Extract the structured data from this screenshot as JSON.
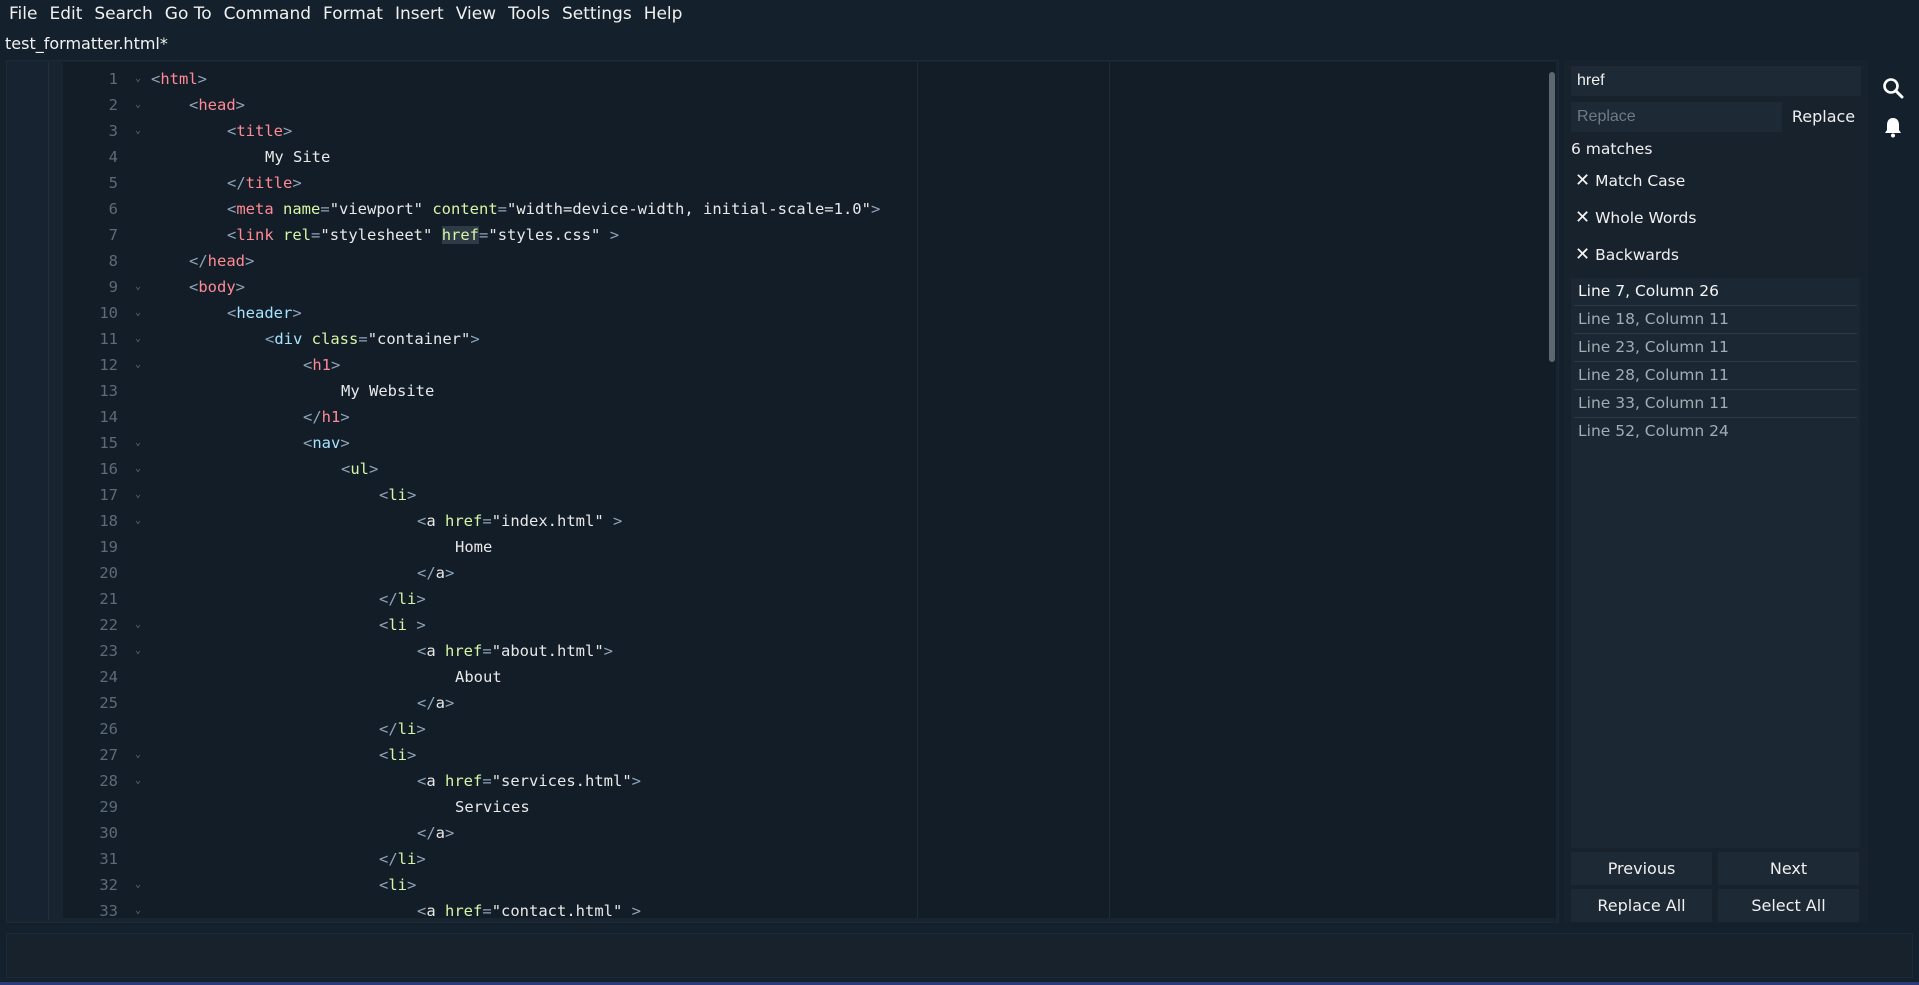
{
  "menu": [
    "File",
    "Edit",
    "Search",
    "Go To",
    "Command",
    "Format",
    "Insert",
    "View",
    "Tools",
    "Settings",
    "Help"
  ],
  "tab_title": "test_formatter.html*",
  "editor": {
    "lines": [
      {
        "n": "1",
        "fold": true,
        "indent": 0,
        "tokens": [
          [
            "p",
            "<"
          ],
          [
            "t",
            "html"
          ],
          [
            "p",
            ">"
          ]
        ]
      },
      {
        "n": "2",
        "fold": true,
        "indent": 1,
        "tokens": [
          [
            "p",
            "<"
          ],
          [
            "t",
            "head"
          ],
          [
            "p",
            ">"
          ]
        ]
      },
      {
        "n": "3",
        "fold": true,
        "indent": 2,
        "tokens": [
          [
            "p",
            "<"
          ],
          [
            "t",
            "title"
          ],
          [
            "p",
            ">"
          ]
        ]
      },
      {
        "n": "4",
        "fold": false,
        "indent": 3,
        "tokens": [
          [
            "s",
            "My Site"
          ]
        ]
      },
      {
        "n": "5",
        "fold": false,
        "indent": 2,
        "tokens": [
          [
            "p",
            "</"
          ],
          [
            "t",
            "title"
          ],
          [
            "p",
            ">"
          ]
        ]
      },
      {
        "n": "6",
        "fold": false,
        "indent": 2,
        "tokens": [
          [
            "p",
            "<"
          ],
          [
            "t",
            "meta "
          ],
          [
            "a",
            "name"
          ],
          [
            "p",
            "="
          ],
          [
            "s",
            "\"viewport\" "
          ],
          [
            "a",
            "content"
          ],
          [
            "p",
            "="
          ],
          [
            "s",
            "\"width=device-width, initial-scale=1.0\""
          ],
          [
            "p",
            ">"
          ]
        ]
      },
      {
        "n": "7",
        "fold": false,
        "indent": 2,
        "tokens": [
          [
            "p",
            "<"
          ],
          [
            "t",
            "link "
          ],
          [
            "a",
            "rel"
          ],
          [
            "p",
            "="
          ],
          [
            "s",
            "\"stylesheet\" "
          ],
          [
            "h",
            "href"
          ],
          [
            "p",
            "="
          ],
          [
            "s",
            "\"styles.css\" "
          ],
          [
            "p",
            ">"
          ]
        ]
      },
      {
        "n": "8",
        "fold": false,
        "indent": 1,
        "tokens": [
          [
            "p",
            "</"
          ],
          [
            "t",
            "head"
          ],
          [
            "p",
            ">"
          ]
        ]
      },
      {
        "n": "9",
        "fold": true,
        "indent": 1,
        "tokens": [
          [
            "p",
            "<"
          ],
          [
            "t",
            "body"
          ],
          [
            "p",
            ">"
          ]
        ]
      },
      {
        "n": "10",
        "fold": true,
        "indent": 2,
        "tokens": [
          [
            "p",
            "<"
          ],
          [
            "t2",
            "header"
          ],
          [
            "p",
            ">"
          ]
        ]
      },
      {
        "n": "11",
        "fold": true,
        "indent": 3,
        "tokens": [
          [
            "p",
            "<"
          ],
          [
            "t2",
            "div "
          ],
          [
            "a",
            "class"
          ],
          [
            "p",
            "="
          ],
          [
            "s",
            "\"container\""
          ],
          [
            "p",
            ">"
          ]
        ]
      },
      {
        "n": "12",
        "fold": true,
        "indent": 4,
        "tokens": [
          [
            "p",
            "<"
          ],
          [
            "t",
            "h1"
          ],
          [
            "p",
            ">"
          ]
        ]
      },
      {
        "n": "13",
        "fold": false,
        "indent": 5,
        "tokens": [
          [
            "s",
            "My Website"
          ]
        ]
      },
      {
        "n": "14",
        "fold": false,
        "indent": 4,
        "tokens": [
          [
            "p",
            "</"
          ],
          [
            "t",
            "h1"
          ],
          [
            "p",
            ">"
          ]
        ]
      },
      {
        "n": "15",
        "fold": true,
        "indent": 4,
        "tokens": [
          [
            "p",
            "<"
          ],
          [
            "t2",
            "nav"
          ],
          [
            "p",
            ">"
          ]
        ]
      },
      {
        "n": "16",
        "fold": true,
        "indent": 5,
        "tokens": [
          [
            "p",
            "<"
          ],
          [
            "a",
            "ul"
          ],
          [
            "p",
            ">"
          ]
        ]
      },
      {
        "n": "17",
        "fold": true,
        "indent": 6,
        "tokens": [
          [
            "p",
            "<"
          ],
          [
            "a",
            "li"
          ],
          [
            "p",
            ">"
          ]
        ]
      },
      {
        "n": "18",
        "fold": true,
        "indent": 7,
        "tokens": [
          [
            "p",
            "<"
          ],
          [
            "s",
            "a "
          ],
          [
            "a",
            "href"
          ],
          [
            "p",
            "="
          ],
          [
            "s",
            "\"index.html\" "
          ],
          [
            "p",
            ">"
          ]
        ]
      },
      {
        "n": "19",
        "fold": false,
        "indent": 8,
        "tokens": [
          [
            "s",
            "Home"
          ]
        ]
      },
      {
        "n": "20",
        "fold": false,
        "indent": 7,
        "tokens": [
          [
            "p",
            "</"
          ],
          [
            "s",
            "a"
          ],
          [
            "p",
            ">"
          ]
        ]
      },
      {
        "n": "21",
        "fold": false,
        "indent": 6,
        "tokens": [
          [
            "p",
            "</"
          ],
          [
            "a",
            "li"
          ],
          [
            "p",
            ">"
          ]
        ]
      },
      {
        "n": "22",
        "fold": true,
        "indent": 6,
        "tokens": [
          [
            "p",
            "<"
          ],
          [
            "a",
            "li "
          ],
          [
            "p",
            ">"
          ]
        ]
      },
      {
        "n": "23",
        "fold": true,
        "indent": 7,
        "tokens": [
          [
            "p",
            "<"
          ],
          [
            "s",
            "a "
          ],
          [
            "a",
            "href"
          ],
          [
            "p",
            "="
          ],
          [
            "s",
            "\"about.html\""
          ],
          [
            "p",
            ">"
          ]
        ]
      },
      {
        "n": "24",
        "fold": false,
        "indent": 8,
        "tokens": [
          [
            "s",
            "About"
          ]
        ]
      },
      {
        "n": "25",
        "fold": false,
        "indent": 7,
        "tokens": [
          [
            "p",
            "</"
          ],
          [
            "s",
            "a"
          ],
          [
            "p",
            ">"
          ]
        ]
      },
      {
        "n": "26",
        "fold": false,
        "indent": 6,
        "tokens": [
          [
            "p",
            "</"
          ],
          [
            "a",
            "li"
          ],
          [
            "p",
            ">"
          ]
        ]
      },
      {
        "n": "27",
        "fold": true,
        "indent": 6,
        "tokens": [
          [
            "p",
            "<"
          ],
          [
            "a",
            "li"
          ],
          [
            "p",
            ">"
          ]
        ]
      },
      {
        "n": "28",
        "fold": true,
        "indent": 7,
        "tokens": [
          [
            "p",
            "<"
          ],
          [
            "s",
            "a "
          ],
          [
            "a",
            "href"
          ],
          [
            "p",
            "="
          ],
          [
            "s",
            "\"services.html\""
          ],
          [
            "p",
            ">"
          ]
        ]
      },
      {
        "n": "29",
        "fold": false,
        "indent": 8,
        "tokens": [
          [
            "s",
            "Services"
          ]
        ]
      },
      {
        "n": "30",
        "fold": false,
        "indent": 7,
        "tokens": [
          [
            "p",
            "</"
          ],
          [
            "s",
            "a"
          ],
          [
            "p",
            ">"
          ]
        ]
      },
      {
        "n": "31",
        "fold": false,
        "indent": 6,
        "tokens": [
          [
            "p",
            "</"
          ],
          [
            "a",
            "li"
          ],
          [
            "p",
            ">"
          ]
        ]
      },
      {
        "n": "32",
        "fold": true,
        "indent": 6,
        "tokens": [
          [
            "p",
            "<"
          ],
          [
            "a",
            "li"
          ],
          [
            "p",
            ">"
          ]
        ]
      },
      {
        "n": "33",
        "fold": true,
        "indent": 7,
        "tokens": [
          [
            "p",
            "<"
          ],
          [
            "s",
            "a "
          ],
          [
            "a",
            "href"
          ],
          [
            "p",
            "="
          ],
          [
            "s",
            "\"contact.html\" "
          ],
          [
            "p",
            ">"
          ]
        ]
      }
    ]
  },
  "find": {
    "query": "href",
    "replace_placeholder": "Replace",
    "replace_label": "Replace",
    "match_count": "6 matches",
    "options": [
      {
        "label": "Match Case",
        "icon": "✕"
      },
      {
        "label": "Whole Words",
        "icon": "✕"
      },
      {
        "label": "Backwards",
        "icon": "✕"
      }
    ],
    "results": [
      "Line 7, Column 26",
      "Line 18, Column 11",
      "Line 23, Column 11",
      "Line 28, Column 11",
      "Line 33, Column 11",
      "Line 52, Column 24"
    ],
    "previous_label": "Previous",
    "next_label": "Next",
    "replace_all_label": "Replace All",
    "select_all_label": "Select All"
  },
  "icons": {
    "search": "search-icon",
    "notifications": "bell-icon"
  }
}
